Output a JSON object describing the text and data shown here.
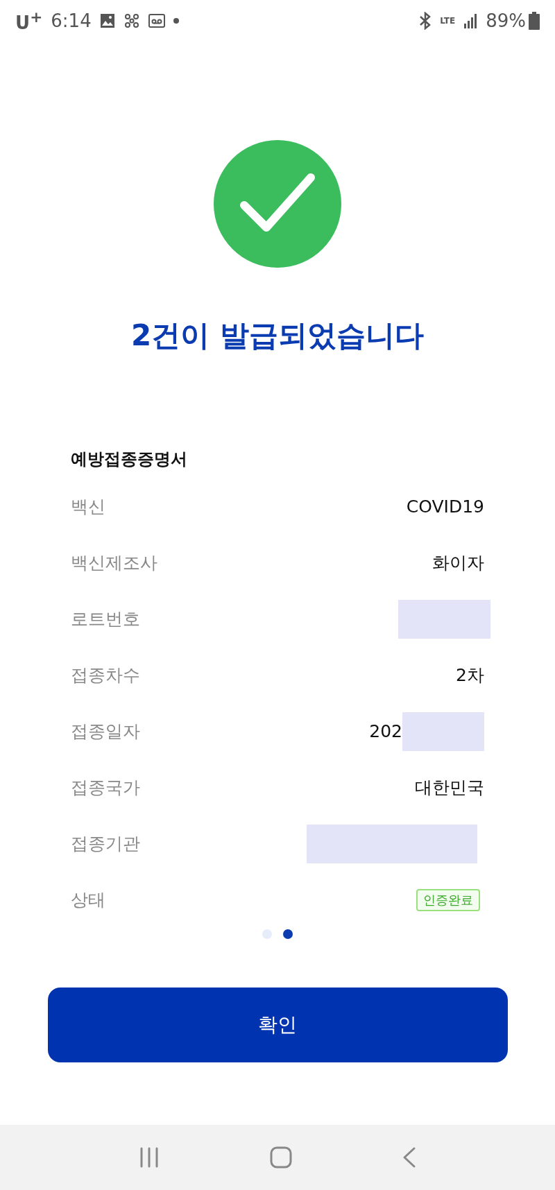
{
  "status_bar": {
    "carrier": "U$^{+}$",
    "time": "6:14",
    "network": "LTE",
    "battery": "89%"
  },
  "result": {
    "title": "2건이 발급되었습니다"
  },
  "certificate": {
    "title": "예방접종증명서",
    "rows": [
      {
        "label": "백신",
        "kind": "text",
        "value": "COVID19"
      },
      {
        "label": "백신제조사",
        "kind": "text",
        "value": "화이자"
      },
      {
        "label": "로트번호",
        "kind": "redacted"
      },
      {
        "label": "접종차수",
        "kind": "text",
        "value": "2차"
      },
      {
        "label": "접종일자",
        "kind": "truncated",
        "value": "202"
      },
      {
        "label": "접종국가",
        "kind": "text",
        "value": "대한민국"
      },
      {
        "label": "접종기관",
        "kind": "obscured"
      },
      {
        "label": "상태",
        "kind": "badge",
        "value": "인증완료"
      }
    ]
  },
  "pager": [
    {
      "selected": false
    },
    {
      "selected": true
    }
  ],
  "confirm_button": "확인"
}
